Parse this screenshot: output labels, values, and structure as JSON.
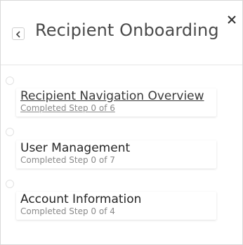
{
  "header": {
    "title": "Recipient Onboarding",
    "back_icon": "chevron-left-icon",
    "close_icon": "close-icon"
  },
  "steps": [
    {
      "title": "Recipient Navigation Overview",
      "status": "Completed Step 0 of 6",
      "active": true
    },
    {
      "title": "User Management",
      "status": "Completed Step 0 of 7",
      "active": false
    },
    {
      "title": "Account Information",
      "status": "Completed Step 0 of 4",
      "active": false
    }
  ]
}
